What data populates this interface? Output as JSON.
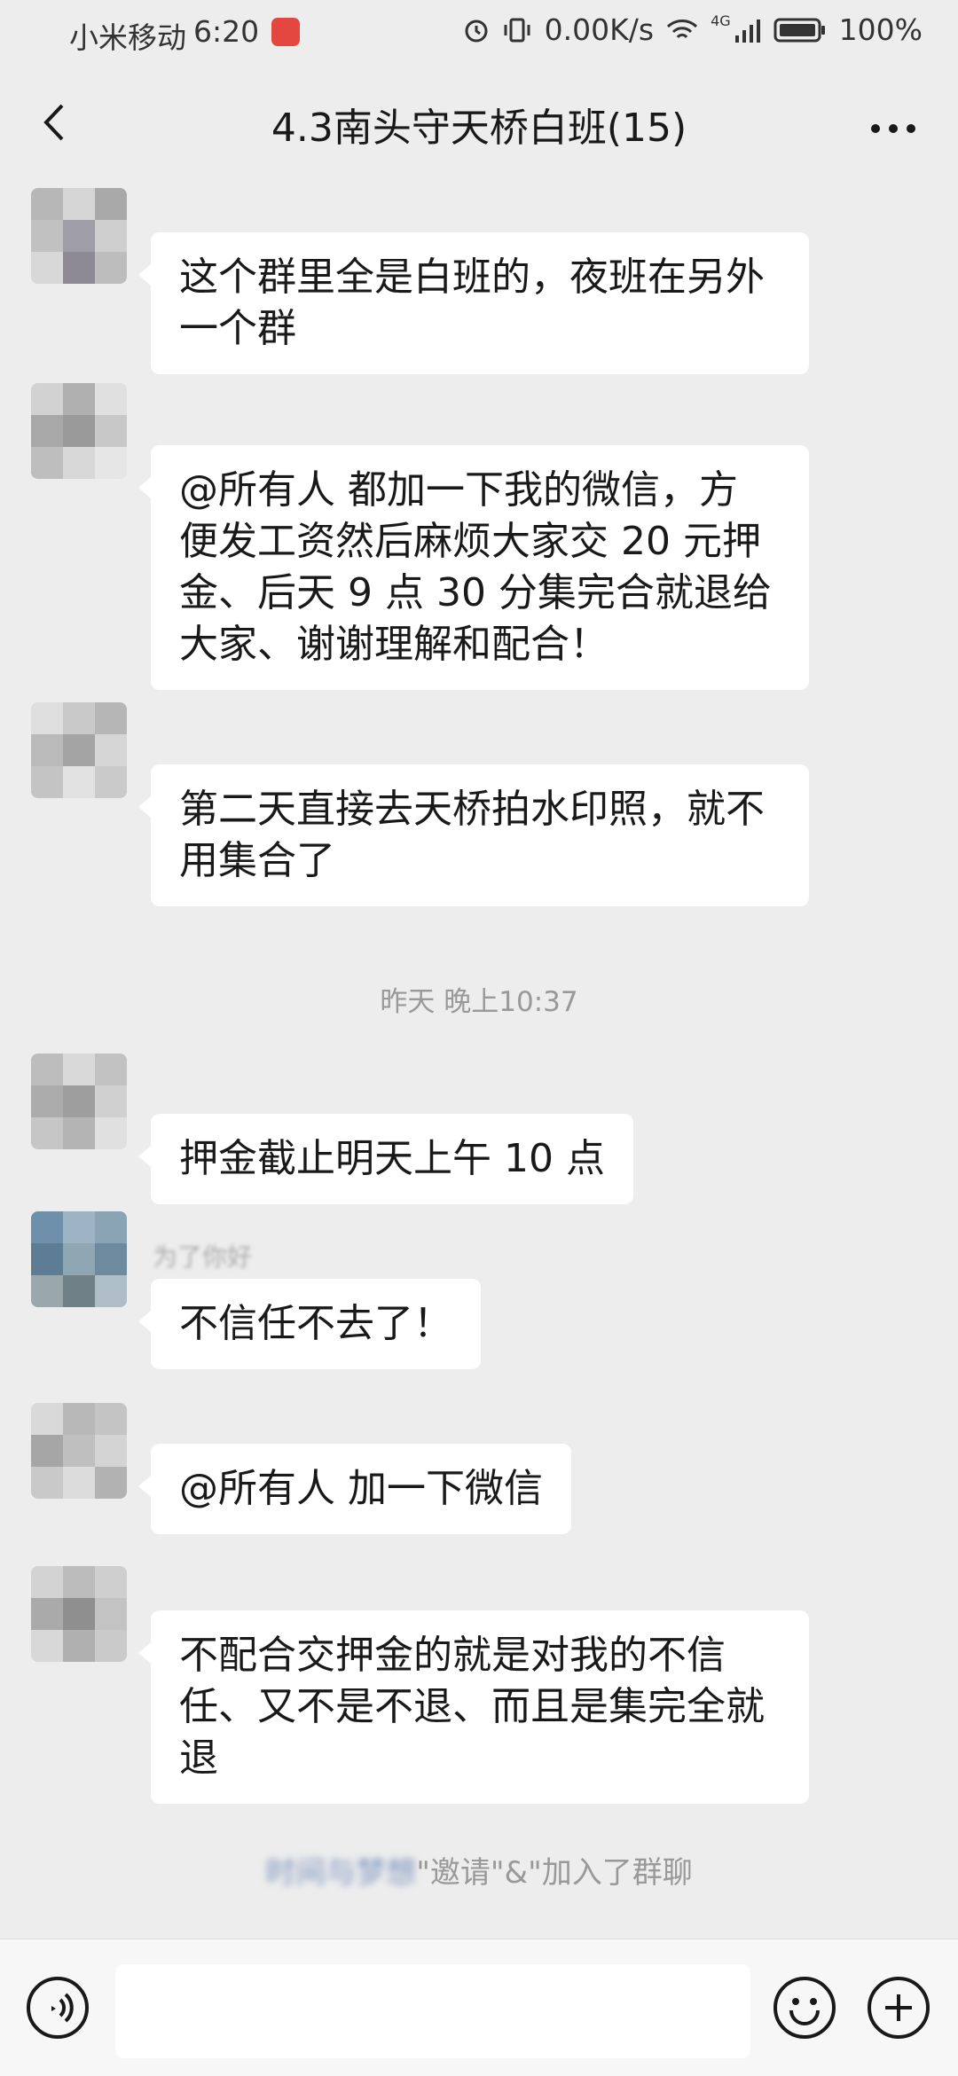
{
  "status_bar": {
    "carrier": "小米移动",
    "time": "6:20",
    "speed": "0.00K/s",
    "network": "4G",
    "battery": "100%",
    "icons": [
      "app-notification-icon",
      "alarm-icon",
      "vibrate-icon",
      "wifi-icon",
      "signal-icon",
      "battery-icon"
    ]
  },
  "header": {
    "title": "4.3南头守天桥白班(15)",
    "back_icon": "chevron-left-icon",
    "more_icon": "more-horizontal-icon"
  },
  "messages": [
    {
      "name": "",
      "text_lines": [
        "这个群里全是白班的，夜班在另外",
        "一个群"
      ]
    },
    {
      "name": "",
      "text_lines": [
        "@所有人  都加一下我的微信，方",
        "便发工资然后麻烦大家交 20 元押",
        "金、后天 9 点 30 分集完合就退给",
        "大家、谢谢理解和配合！"
      ]
    },
    {
      "name": "",
      "text_lines": [
        "第二天直接去天桥拍水印照，就不",
        "用集合了"
      ]
    },
    {
      "name": "",
      "text_lines": [
        "押金截止明天上午 10 点"
      ]
    },
    {
      "name": "为了你好",
      "text_lines": [
        "不信任不去了！"
      ]
    },
    {
      "name": "",
      "text_lines": [
        "@所有人  加一下微信"
      ]
    },
    {
      "name": "",
      "text_lines": [
        "不配合交押金的就是对我的不信",
        "任、又不是不退、而且是集完全就",
        "退"
      ]
    }
  ],
  "timestamp": "昨天 晚上10:37",
  "system_message": {
    "blurred_name": "时间与梦想",
    "text": "\"邀请\"&\"加入了群聊"
  },
  "input_bar": {
    "voice_icon": "voice-icon",
    "emoji_icon": "emoji-icon",
    "add_icon": "plus-circle-icon",
    "placeholder": ""
  },
  "colors": {
    "background": "#ededed",
    "bubble": "#ffffff",
    "text": "#191919",
    "meta_text": "#999999",
    "link_blue": "#576b95"
  }
}
